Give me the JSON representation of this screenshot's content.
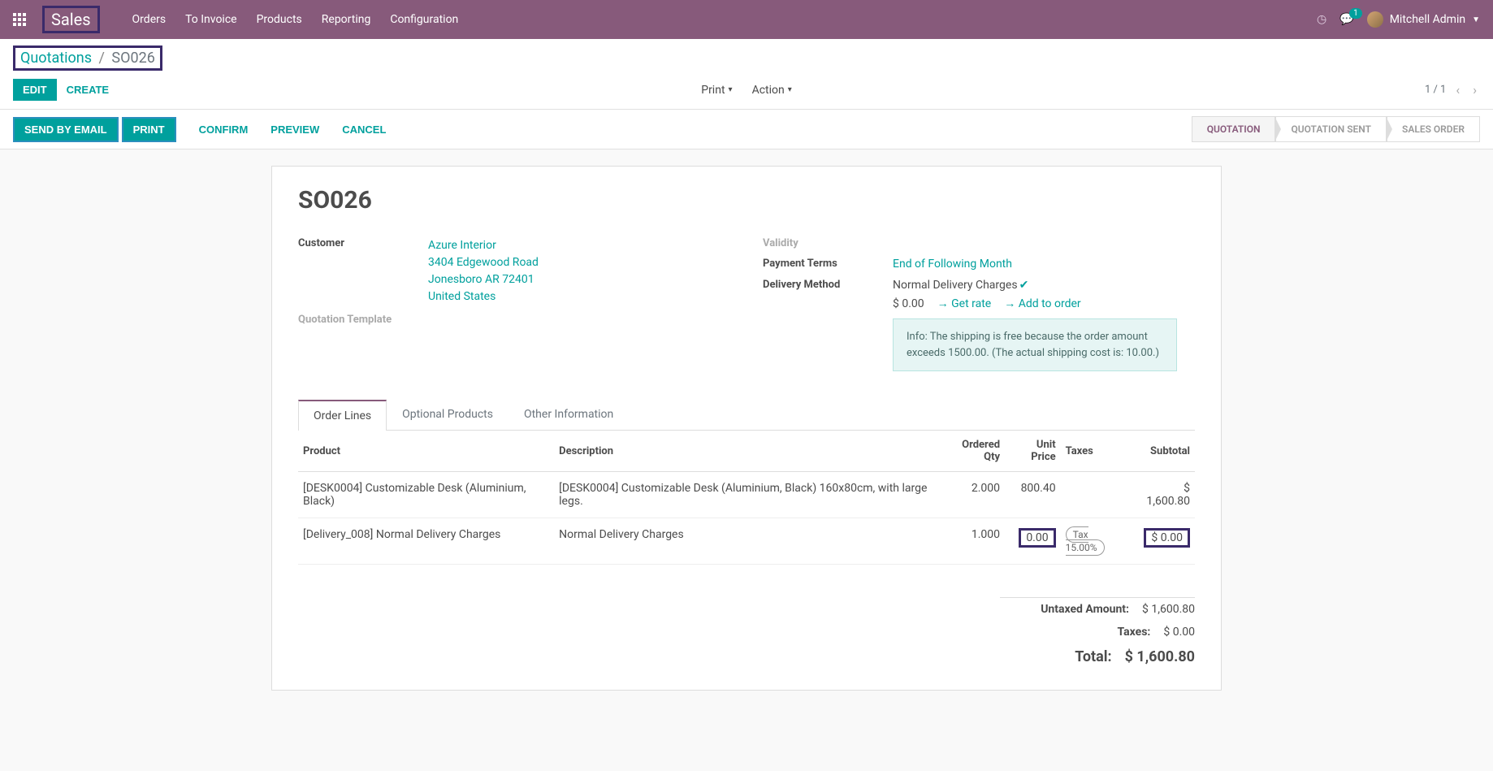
{
  "app": {
    "title": "Sales"
  },
  "nav": {
    "items": [
      "Orders",
      "To Invoice",
      "Products",
      "Reporting",
      "Configuration"
    ],
    "chat_count": "1",
    "user": "Mitchell Admin"
  },
  "breadcrumb": {
    "root": "Quotations",
    "current": "SO026"
  },
  "buttons": {
    "edit": "EDIT",
    "create": "CREATE",
    "print_menu": "Print",
    "action_menu": "Action",
    "pager": "1 / 1",
    "send_by_email": "SEND BY EMAIL",
    "print": "PRINT",
    "confirm": "CONFIRM",
    "preview": "PREVIEW",
    "cancel": "CANCEL"
  },
  "status": {
    "steps": [
      "QUOTATION",
      "QUOTATION SENT",
      "SALES ORDER"
    ]
  },
  "order": {
    "name": "SO026",
    "customer_label": "Customer",
    "customer_name": "Azure Interior",
    "customer_addr1": "3404 Edgewood Road",
    "customer_addr2": "Jonesboro AR 72401",
    "customer_country": "United States",
    "quote_template_label": "Quotation Template",
    "validity_label": "Validity",
    "payment_terms_label": "Payment Terms",
    "payment_terms": "End of Following Month",
    "delivery_method_label": "Delivery Method",
    "delivery_method": "Normal Delivery Charges",
    "rate_amount": "$ 0.00",
    "get_rate": "Get rate",
    "add_to_order": "Add to order",
    "info": "Info: The shipping is free because the order amount exceeds 1500.00. (The actual shipping cost is: 10.00.)"
  },
  "tabs": {
    "order_lines": "Order Lines",
    "optional": "Optional Products",
    "other": "Other Information"
  },
  "columns": {
    "product": "Product",
    "description": "Description",
    "qty": "Ordered Qty",
    "price": "Unit Price",
    "taxes": "Taxes",
    "subtotal": "Subtotal"
  },
  "lines": [
    {
      "product": "[DESK0004] Customizable Desk (Aluminium, Black)",
      "description": "[DESK0004] Customizable Desk (Aluminium, Black) 160x80cm, with large legs.",
      "qty": "2.000",
      "price": "800.40",
      "tax": "",
      "subtotal": "$ 1,600.80"
    },
    {
      "product": "[Delivery_008] Normal Delivery Charges",
      "description": "Normal Delivery Charges",
      "qty": "1.000",
      "price": "0.00",
      "tax": "Tax 15.00%",
      "subtotal": "$ 0.00"
    }
  ],
  "totals": {
    "untaxed_label": "Untaxed Amount:",
    "untaxed": "$ 1,600.80",
    "taxes_label": "Taxes:",
    "taxes": "$ 0.00",
    "total_label": "Total:",
    "total": "$ 1,600.80"
  }
}
